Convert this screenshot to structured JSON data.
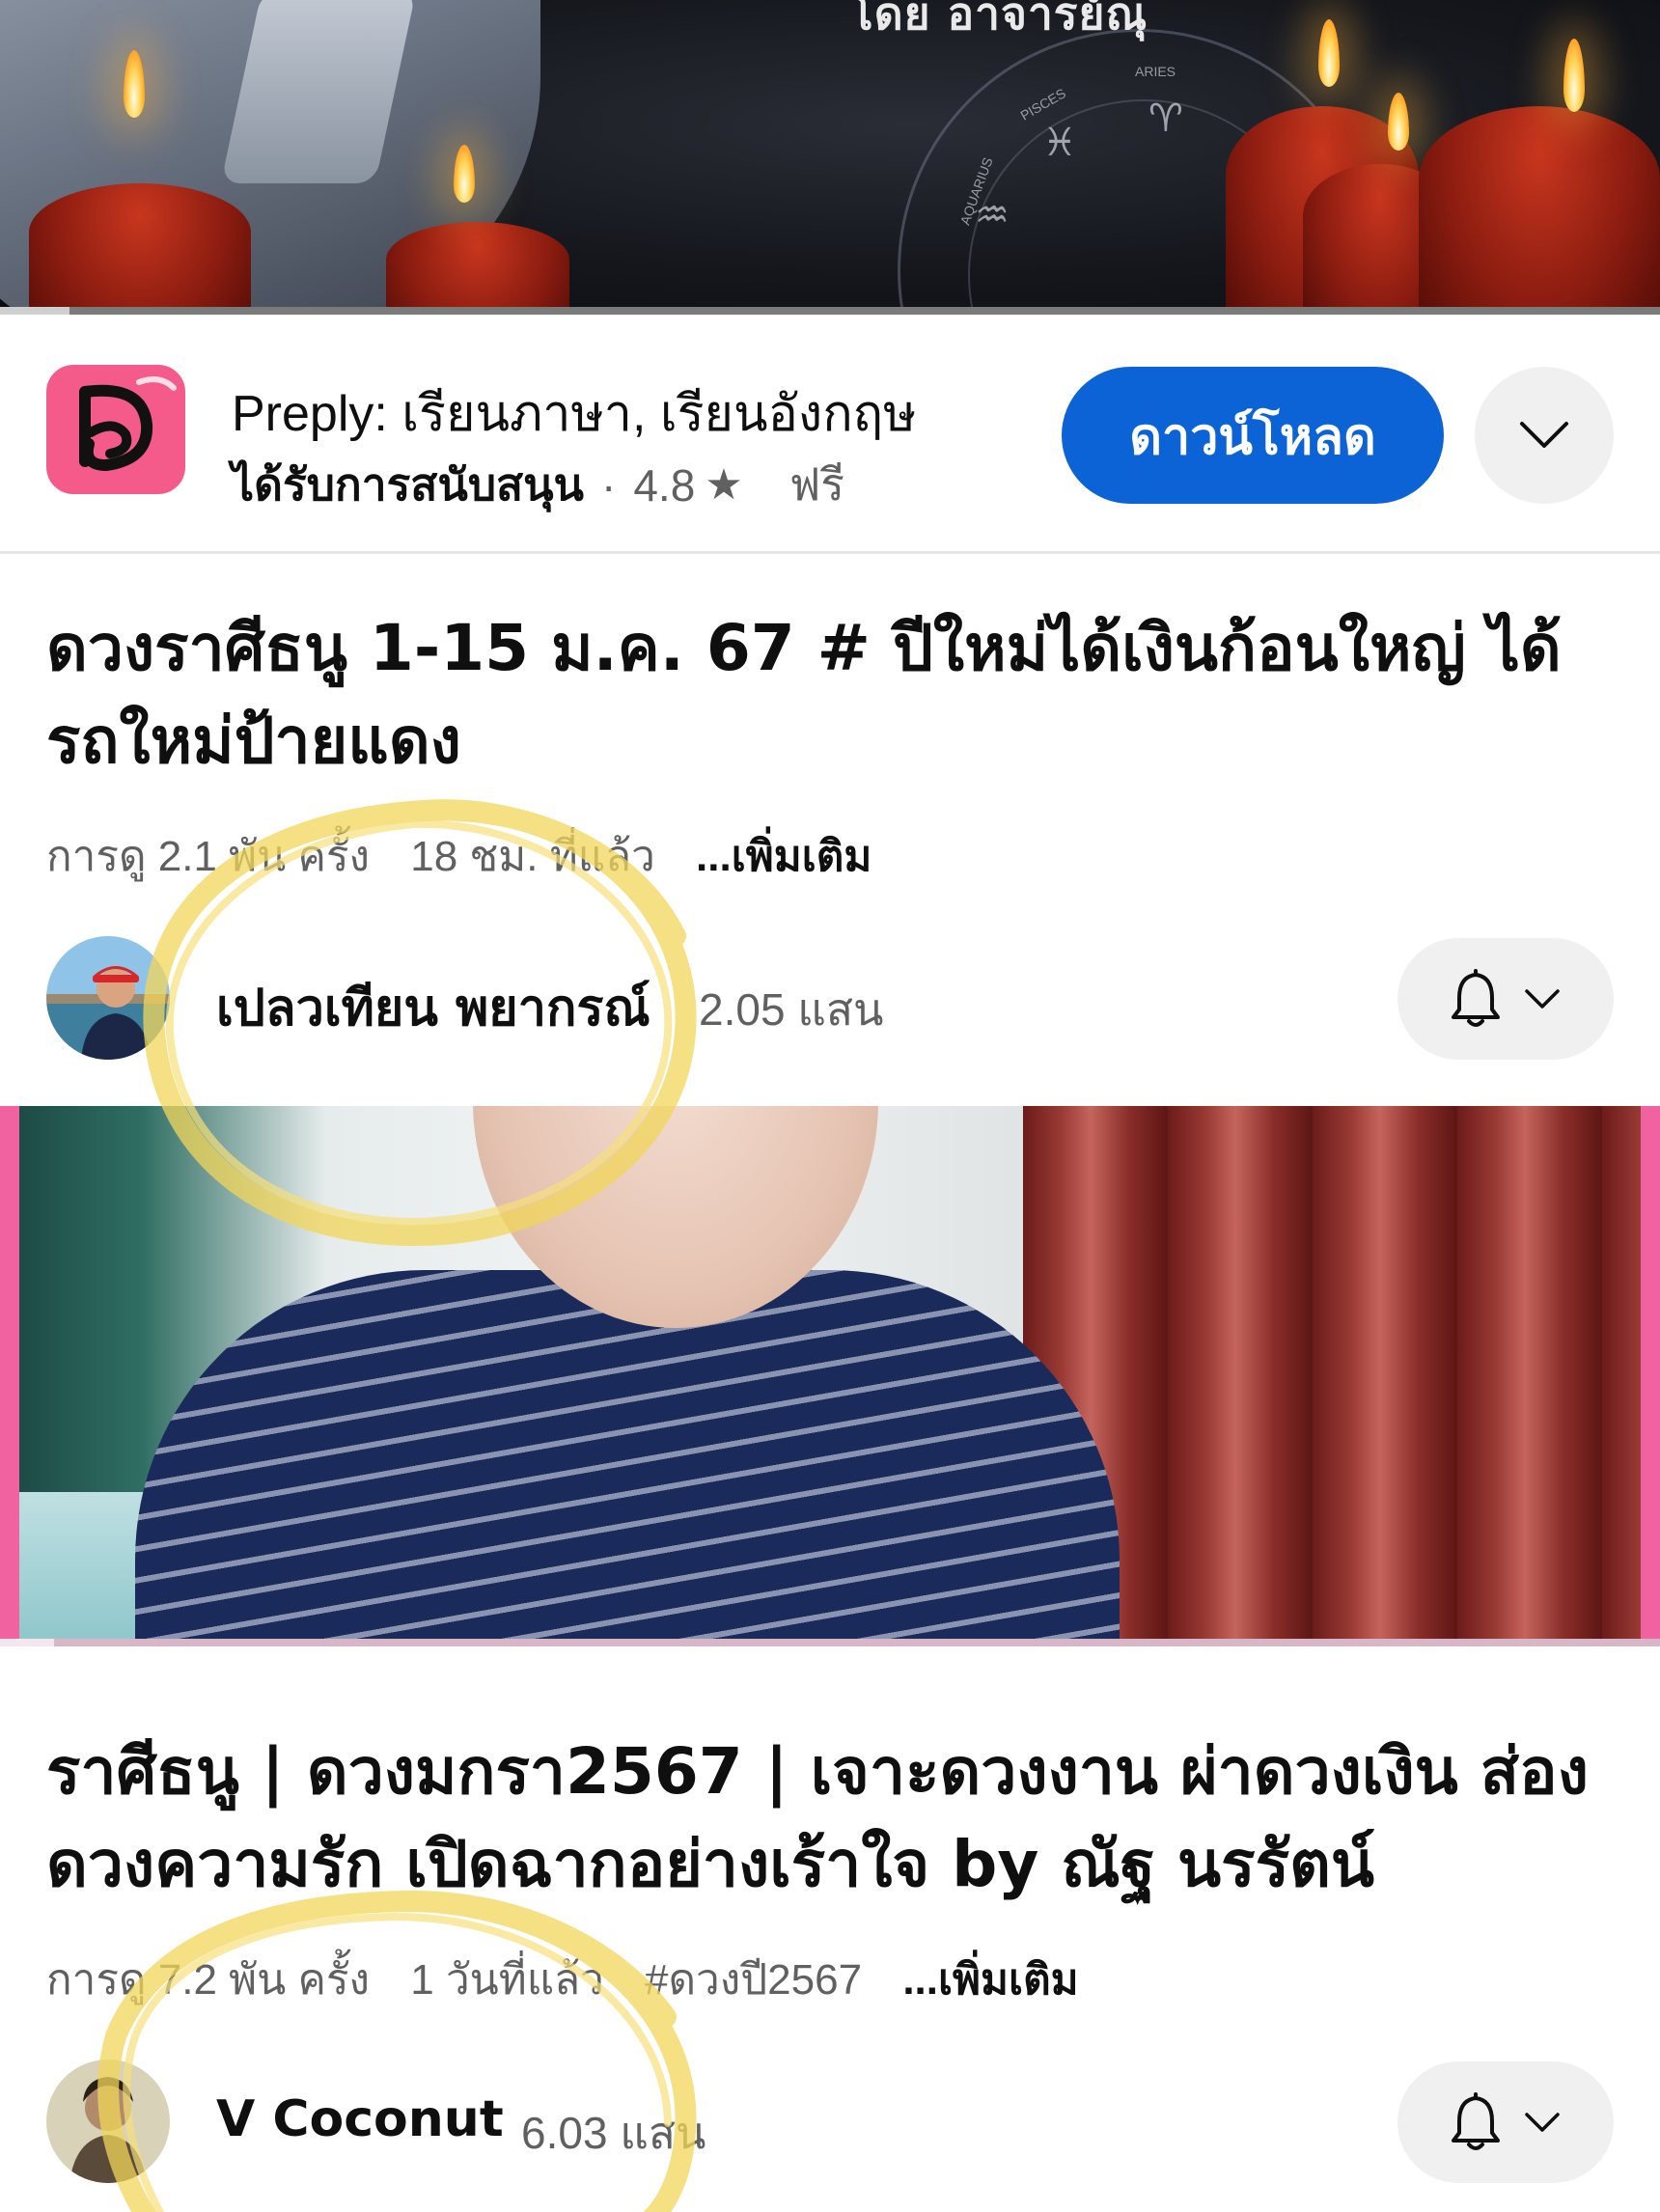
{
  "top_video": {
    "thumbnail_text": "โดย อาจารย์ณุ",
    "zodiac_labels": [
      "ARIES",
      "PISCES",
      "AQUARIUS"
    ]
  },
  "ad": {
    "title": "Preply: เรียนภาษา, เรียนอังกฤษ",
    "sponsored_label": "ได้รับการสนับสนุน",
    "rating": "4.8",
    "star_icon": "★",
    "price": "ฟรี",
    "download_label": "ดาวน์โหลด",
    "brand_color": "#f45b8a",
    "button_color": "#0b63d6"
  },
  "video1": {
    "title": "ดวงราศีธนู 1-15 ม.ค. 67 # ปีใหม่ได้เงินก้อนใหญ่ ได้รถใหม่ป้ายแดง",
    "views": "การดู 2.1 พัน ครั้ง",
    "age": "18 ชม. ที่แล้ว",
    "more": "...เพิ่มเติม",
    "channel": "เปลวเทียน พยากรณ์",
    "subscribers": "2.05 แสน"
  },
  "video2": {
    "title": "ราศีธนู | ดวงมกรา2567 | เจาะดวงงาน ผ่าดวงเงิน ส่องดวงความรัก เปิดฉากอย่างเร้าใจ  by ณัฐ นรรัตน์",
    "views": "การดู 7.2 พัน ครั้ง",
    "age": "1 วันที่แล้ว",
    "hashtag": "#ดวงปี2567",
    "more": "...เพิ่มเติม",
    "channel": "V Coconut",
    "subscribers": "6.03 แสน"
  },
  "icons": {
    "chevron": "chevron-down-icon",
    "bell": "bell-icon"
  }
}
